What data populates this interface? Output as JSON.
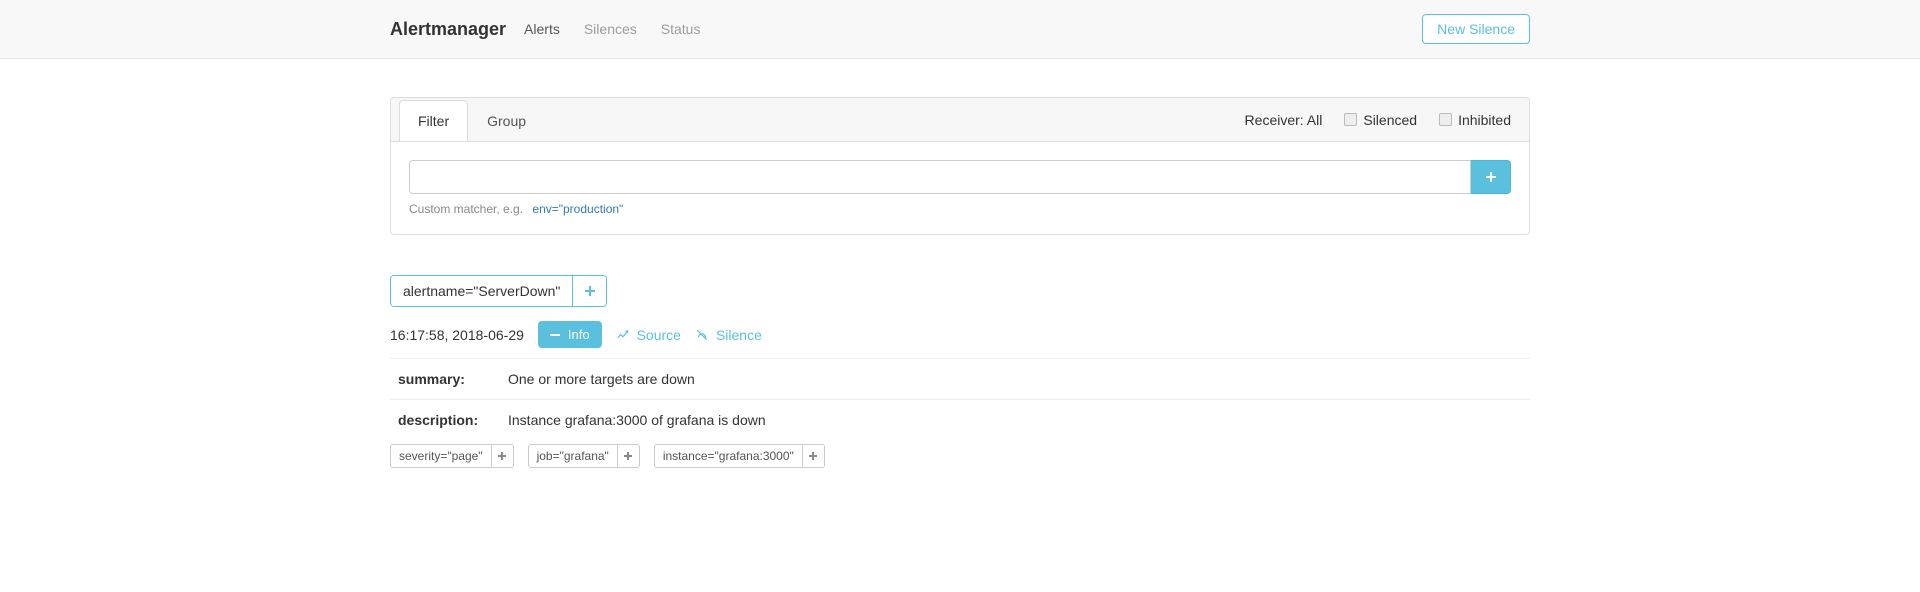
{
  "nav": {
    "brand": "Alertmanager",
    "links": [
      "Alerts",
      "Silences",
      "Status"
    ],
    "new_silence": "New Silence"
  },
  "panel": {
    "tabs": [
      "Filter",
      "Group"
    ],
    "receiver_label": "Receiver: All",
    "silenced_label": "Silenced",
    "inhibited_label": "Inhibited",
    "filter_value": "",
    "matcher_hint": "Custom matcher, e.g.",
    "matcher_example": "env=\"production\""
  },
  "group": {
    "tag": "alertname=\"ServerDown\""
  },
  "alert": {
    "timestamp": "16:17:58, 2018-06-29",
    "info_label": "Info",
    "source_label": "Source",
    "silence_label": "Silence",
    "annotations": [
      {
        "key": "summary:",
        "value": "One or more targets are down"
      },
      {
        "key": "description:",
        "value": "Instance grafana:3000 of grafana is down"
      }
    ],
    "labels": [
      "severity=\"page\"",
      "job=\"grafana\"",
      "instance=\"grafana:3000\""
    ]
  }
}
